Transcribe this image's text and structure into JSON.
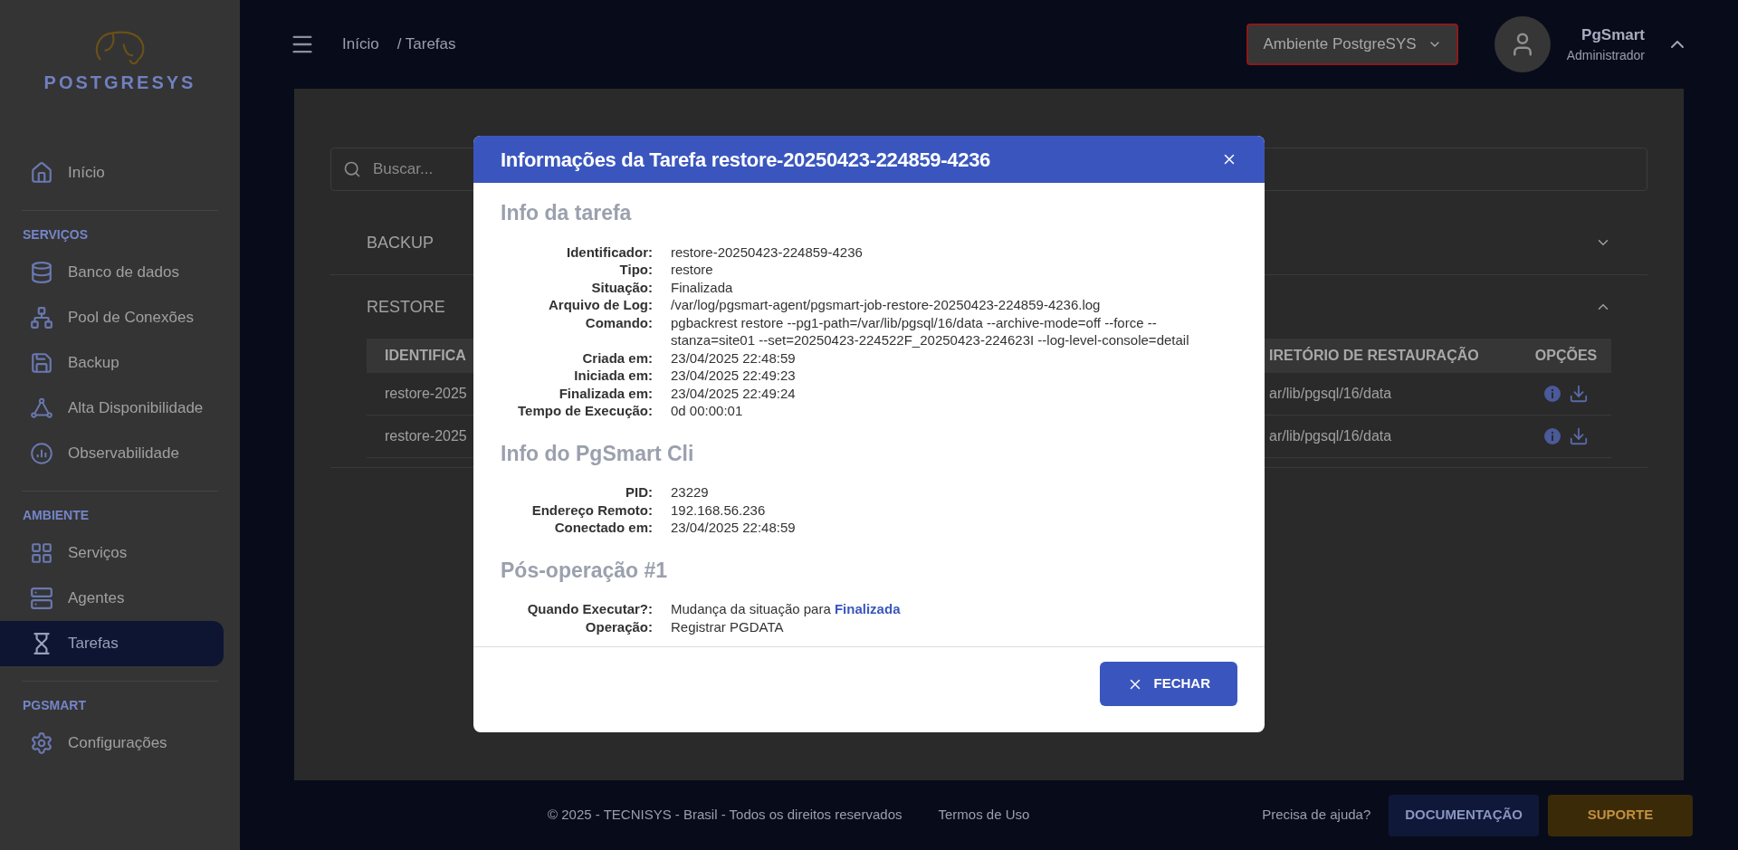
{
  "sidebar": {
    "logo_text": "POSTGRESYS",
    "home": {
      "label": "Início",
      "selected": false
    },
    "sections": [
      {
        "title": "SERVIÇOS",
        "items": [
          {
            "label": "Banco de dados",
            "selected": false
          },
          {
            "label": "Pool de Conexões",
            "selected": false
          },
          {
            "label": "Backup",
            "selected": false
          },
          {
            "label": "Alta Disponibilidade",
            "selected": false
          },
          {
            "label": "Observabilidade",
            "selected": false
          }
        ]
      },
      {
        "title": "AMBIENTE",
        "items": [
          {
            "label": "Serviços",
            "selected": false
          },
          {
            "label": "Agentes",
            "selected": false
          },
          {
            "label": "Tarefas",
            "selected": true
          }
        ]
      },
      {
        "title": "PGSMART",
        "items": [
          {
            "label": "Configurações",
            "selected": false
          }
        ]
      }
    ]
  },
  "header": {
    "breadcrumb": [
      "Início",
      "/ Tarefas"
    ],
    "environment": "Ambiente PostgreSYS",
    "user": {
      "name": "PgSmart",
      "role": "Administrador"
    }
  },
  "search": {
    "placeholder": "Buscar..."
  },
  "accordions": [
    {
      "title": "BACKUP",
      "expanded": false
    },
    {
      "title": "RESTORE",
      "expanded": true
    }
  ],
  "table": {
    "columns": [
      "IDENTIFICA",
      "IRETÓRIO DE RESTAURAÇÃO",
      "OPÇÕES"
    ],
    "rows": [
      {
        "cells": [
          "restore-2025",
          "ar/lib/pgsql/16/data"
        ]
      },
      {
        "cells": [
          "restore-2025",
          "ar/lib/pgsql/16/data"
        ]
      }
    ]
  },
  "dialog": {
    "title": "Informações da Tarefa restore-20250423-224859-4236",
    "sections": [
      {
        "title": "Info da tarefa",
        "fields": [
          {
            "label": "Identificador:",
            "value": "restore-20250423-224859-4236"
          },
          {
            "label": "Tipo:",
            "value": "restore"
          },
          {
            "label": "Situação:",
            "value": "Finalizada"
          },
          {
            "label": "Arquivo de Log:",
            "value": "/var/log/pgsmart-agent/pgsmart-job-restore-20250423-224859-4236.log"
          },
          {
            "label": "Comando:",
            "value": "pgbackrest restore --pg1-path=/var/lib/pgsql/16/data --archive-mode=off --force --stanza=site01 --set=20250423-224522F_20250423-224623I --log-level-console=detail"
          },
          {
            "label": "Criada em:",
            "value": "23/04/2025 22:48:59"
          },
          {
            "label": "Iniciada em:",
            "value": "23/04/2025 22:49:23"
          },
          {
            "label": "Finalizada em:",
            "value": "23/04/2025 22:49:24"
          },
          {
            "label": "Tempo de Execução:",
            "value": "0d 00:00:01"
          }
        ]
      },
      {
        "title": "Info do PgSmart Cli",
        "fields": [
          {
            "label": "PID:",
            "value": "23229"
          },
          {
            "label": "Endereço Remoto:",
            "value": "192.168.56.236"
          },
          {
            "label": "Conectado em:",
            "value": "23/04/2025 22:48:59"
          }
        ]
      },
      {
        "title": "Pós-operação #1",
        "fields": [
          {
            "label": "Quando Executar?:",
            "value": "Mudança da situação para **Finalizada**"
          },
          {
            "label": "Operação:",
            "value": "Registrar PGDATA"
          }
        ]
      }
    ],
    "button": "FECHAR"
  },
  "footer": {
    "copyright": "© 2025 - TECNISYS - Brasil - Todos os direitos reservados",
    "terms": "Termos de Uso",
    "help": "Precisa de ajuda?",
    "buttons": [
      "DOCUMENTAÇÃO",
      "SUPORTE"
    ]
  }
}
